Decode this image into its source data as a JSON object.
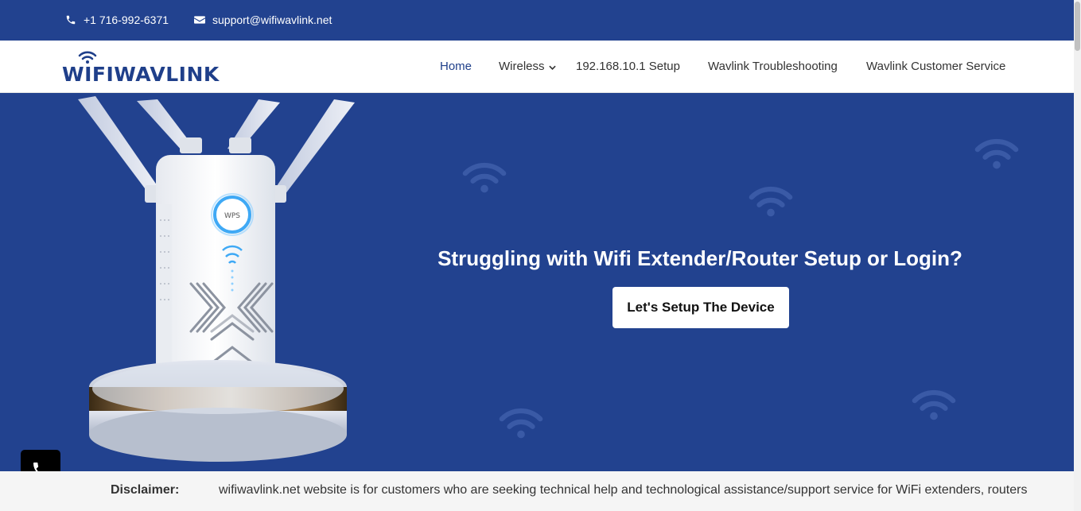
{
  "topbar": {
    "phone": "+1 716-992-6371",
    "email": "support@wifiwavlink.net",
    "phone_icon": "phone-icon",
    "email_icon": "envelope-icon",
    "background": "#22428f"
  },
  "header": {
    "logo_text": "WIFIWAVLINK",
    "nav": [
      {
        "label": "Home",
        "active": true
      },
      {
        "label": "Wireless",
        "has_dropdown": true
      },
      {
        "label": "192.168.10.1 Setup"
      },
      {
        "label": "Wavlink Troubleshooting"
      },
      {
        "label": "Wavlink Customer Service"
      }
    ]
  },
  "hero": {
    "title": "Struggling with Wifi Extender/Router Setup or Login?",
    "cta_label": "Let's Setup The Device",
    "device_label": "WPS",
    "background": "#22428f"
  },
  "call_button": {
    "icon": "phone-icon"
  },
  "disclaimer": {
    "label": "Disclaimer:",
    "text": "wifiwavlink.net website is for customers who are seeking technical help and technological assistance/support service for WiFi extenders, routers"
  },
  "colors": {
    "brand": "#1f3f8a",
    "accent_glow": "#3fa9f5"
  }
}
